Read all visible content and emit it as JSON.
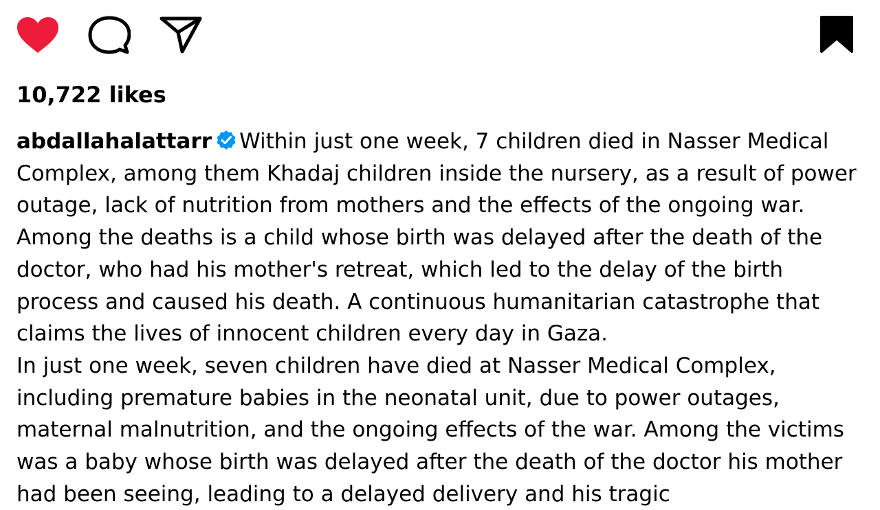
{
  "actions": {
    "like_icon": "heart-filled-icon",
    "comment_icon": "comment-icon",
    "share_icon": "paper-plane-icon",
    "save_icon": "bookmark-filled-icon",
    "like_color": "#ED1C3B",
    "icon_color": "#000000"
  },
  "post": {
    "likes_text": "10,722 likes",
    "username": "abdallahalattarr",
    "verified_color": "#0095F6",
    "caption_paragraph_1": "Within just one week, 7 children died in Nasser Medical Complex, among them Khadaj children inside the nursery, as a result of power outage, lack of nutrition from mothers and the effects of the ongoing war. Among the deaths is a child whose birth was delayed after the death of the doctor, who had his mother's retreat, which led to the delay of the birth process and caused his death. A continuous humanitarian catastrophe that claims the lives of innocent children every day in Gaza.",
    "caption_paragraph_2": "In just one week, seven children have died at Nasser Medical Complex, including premature babies in the neonatal unit, due to power outages, maternal malnutrition, and the ongoing effects of the war. Among the victims was a baby whose birth was delayed after the death of the doctor his mother had been seeing, leading to a delayed delivery and his tragic"
  }
}
